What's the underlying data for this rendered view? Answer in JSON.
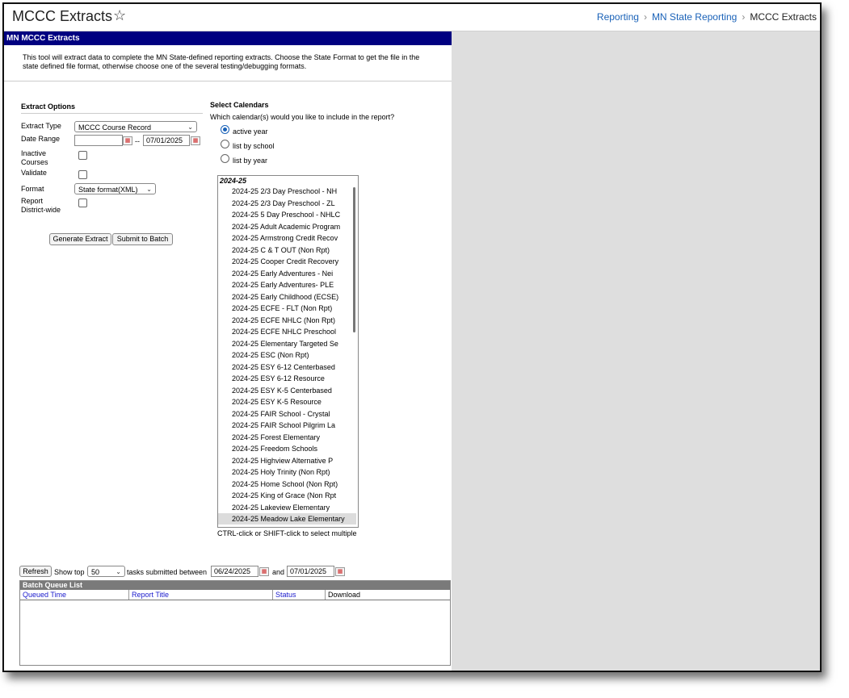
{
  "header": {
    "title": "MCCC Extracts",
    "breadcrumbs": [
      "Reporting",
      "MN State Reporting",
      "MCCC Extracts"
    ]
  },
  "tool": {
    "bar_title": "MN MCCC Extracts",
    "description": "This tool will extract data to complete the MN State-defined reporting extracts. Choose the State Format to get the file in the state defined file format, otherwise choose one of the several testing/debugging formats."
  },
  "options": {
    "heading": "Extract Options",
    "extract_type_label": "Extract Type",
    "extract_type_value": "MCCC Course Record",
    "date_range_label": "Date Range",
    "date_from": "",
    "date_separator": "--",
    "date_to": "07/01/2025",
    "inactive_label_1": "Inactive",
    "inactive_label_2": "Courses",
    "validate_label": "Validate",
    "format_label": "Format",
    "format_value": "State format(XML)",
    "report_label_1": "Report",
    "report_label_2": "District-wide",
    "generate_button": "Generate Extract",
    "submit_button": "Submit to Batch"
  },
  "calendars": {
    "heading": "Select Calendars",
    "question": "Which calendar(s) would you like to include in the report?",
    "radio_active": "active year",
    "radio_school": "list by school",
    "radio_year": "list by year",
    "group_label": "2024-25",
    "items": [
      "2024-25 2/3 Day Preschool - NH",
      "2024-25 2/3 Day Preschool - ZL",
      "2024-25 5 Day Preschool - NHLC",
      "2024-25 Adult Academic Program",
      "2024-25 Armstrong Credit Recov",
      "2024-25 C & T OUT (Non Rpt)",
      "2024-25 Cooper Credit Recovery",
      "2024-25 Early Adventures - Nei",
      "2024-25 Early Adventures- PLE",
      "2024-25 Early Childhood (ECSE)",
      "2024-25 ECFE - FLT (Non Rpt)",
      "2024-25 ECFE NHLC (Non Rpt)",
      "2024-25 ECFE NHLC Preschool",
      "2024-25 Elementary Targeted Se",
      "2024-25 ESC (Non Rpt)",
      "2024-25 ESY 6-12 Centerbased",
      "2024-25 ESY 6-12 Resource",
      "2024-25 ESY K-5 Centerbased",
      "2024-25 ESY K-5 Resource",
      "2024-25 FAIR School - Crystal",
      "2024-25 FAIR School Pilgrim La",
      "2024-25 Forest Elementary",
      "2024-25 Freedom Schools",
      "2024-25 Highview Alternative P",
      "2024-25 Holy Trinity (Non Rpt)",
      "2024-25 Home School (Non Rpt)",
      "2024-25 King of Grace (Non Rpt",
      "2024-25 Lakeview Elementary",
      "2024-25 Meadow Lake Elementary"
    ],
    "hint": "CTRL-click or SHIFT-click to select multiple"
  },
  "batch": {
    "refresh_button": "Refresh",
    "show_top_label": "Show top",
    "show_top_value": "50",
    "tasks_label": "tasks submitted between",
    "from_date": "06/24/2025",
    "and_label": "and",
    "to_date": "07/01/2025",
    "list_title": "Batch Queue List",
    "columns": [
      "Queued Time",
      "Report Title",
      "Status",
      "Download"
    ]
  },
  "colors": {
    "tool_bar": "#000080",
    "link": "#1a62b8",
    "background": "#dedede"
  }
}
